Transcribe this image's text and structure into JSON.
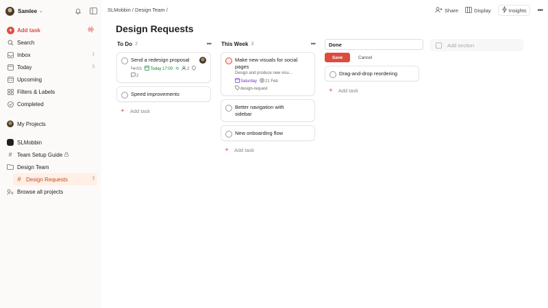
{
  "sidebar": {
    "user_name": "Samlee",
    "add_task": "Add task",
    "nav": [
      {
        "label": "Search",
        "count": ""
      },
      {
        "label": "Inbox",
        "count": "1"
      },
      {
        "label": "Today",
        "count": "3"
      },
      {
        "label": "Upcoming",
        "count": ""
      },
      {
        "label": "Filters & Labels",
        "count": ""
      },
      {
        "label": "Completed",
        "count": ""
      }
    ],
    "my_projects": "My Projects",
    "workspace": "SLMobbin",
    "projects": [
      {
        "label": "Team Setup Guide",
        "count": ""
      },
      {
        "label": "Design Team",
        "count": ""
      },
      {
        "label": "Design Requests",
        "count": "7"
      }
    ],
    "browse": "Browse all projects"
  },
  "header": {
    "breadcrumb": "SLMobbin / Design Team /",
    "share": "Share",
    "display": "Display",
    "insights": "Insights"
  },
  "page_title": "Design Requests",
  "columns": [
    {
      "title": "To Do",
      "count": "2",
      "tasks": [
        {
          "title": "Send a redesign proposal",
          "subtasks": "0/1",
          "date": "Today 17:00",
          "assignees": "2",
          "comments": "2"
        },
        {
          "title": "Speed improvements"
        }
      ],
      "add_task": "Add task"
    },
    {
      "title": "This Week",
      "count": "3",
      "tasks": [
        {
          "title": "Make new visuals for social pages",
          "desc": "Design and produce new visu...",
          "date": "Saturday",
          "deadline": "21 Feb",
          "label": "design-request"
        },
        {
          "title": "Better navigation with sidebar"
        },
        {
          "title": "New onboarding flow"
        }
      ],
      "add_task": "Add task"
    },
    {
      "title_value": "Done",
      "save": "Save",
      "cancel": "Cancel",
      "tasks": [
        {
          "title": "Drag-and-drop reordering"
        }
      ],
      "add_task": "Add task"
    }
  ],
  "add_section": "Add section",
  "colors": {
    "accent": "#dc4c3e",
    "active_bg": "#ffefe5",
    "green": "#058527",
    "purple": "#692ec2"
  }
}
